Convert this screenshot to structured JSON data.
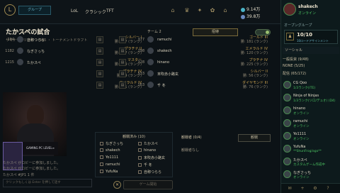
{
  "topbar": {
    "play_label": "グループ",
    "nav": [
      "LoL",
      "クラシック",
      "TFT"
    ],
    "currency": {
      "rp": "9.14万",
      "be": "39.8万"
    }
  },
  "lobby": {
    "title": "たかスペの試合",
    "subtitle": "サモナーズリフト ・ 5v5 ・ トーナメントドラフト",
    "invite_label": "招待",
    "team1_label": "チーム 1",
    "team2_label": "チーム 2"
  },
  "team1": [
    {
      "num": "104",
      "name": "自称つらら",
      "rank": "シルバー I",
      "sub": "勝: 177 (ランク)"
    },
    {
      "num": "1182",
      "name": "なぎさっち",
      "rank": "プラチナ II",
      "sub": "勝: 287 (ランク)"
    },
    {
      "num": "1215",
      "name": "たかスペ",
      "rank": "マスター",
      "sub": "勝: 279 (ランク)"
    },
    {
      "num": "",
      "name": "",
      "rank": "プラチナ IV",
      "sub": "勝: 84 (ランク)"
    },
    {
      "num": "",
      "name": "",
      "rank": "エメラルド IV",
      "sub": "勝: 181 (ランク)"
    }
  ],
  "team2": [
    {
      "num": "377",
      "name": "ramuchi",
      "rank": "ゴールド III",
      "sub": "勝: 181 (ランク)"
    },
    {
      "num": "198",
      "name": "shakech",
      "rank": "エメラルド IV",
      "sub": "勝: 120 (ランク)"
    },
    {
      "num": "328",
      "name": "hinano",
      "rank": "プラチナ IV",
      "sub": "勝: 225 (ランク)"
    },
    {
      "num": "533",
      "name": "末吹赤小路玄",
      "rank": "シルバー II",
      "sub": "勝: 56 (ランク)"
    },
    {
      "num": "163",
      "name": "千 冬",
      "rank": "ダイヤモンド III",
      "sub": "勝: 76 (ランク)"
    }
  ],
  "spectators": {
    "title": "観戦済み (10)",
    "items": [
      "なぎさっち",
      "たかスペ",
      "shakech",
      "hinano",
      "Yo1111",
      "末吹赤小路玄",
      "ramuchi",
      "千 冬",
      "YufuNa",
      "自称つらら"
    ]
  },
  "observers": {
    "title": "観戦者 (0/4)",
    "note": "観戦者なし",
    "button": "観戦"
  },
  "bottom": {
    "start_label": "ゲーム開始",
    "chat_placeholder": "クリックもしくは Enter を押して話す",
    "chat_lines": [
      "たかスペ がロビーに参加しました。",
      "たかスペ がロビーに参加しました。",
      "たかスペ #JP1 1 件"
    ],
    "brand": "GAMING PC LEVEL∞"
  },
  "side": {
    "me_name": "shakech",
    "me_status": "オンライン",
    "open_group": "オープングループ",
    "group_count": "10/10",
    "group_label": "10ロードアサインメント",
    "social": "ソーシャル",
    "categories": [
      "一般投資 (9/48)",
      "NONE (5/25)",
      "配信 (65/172)"
    ],
    "friends": [
      {
        "name": "CG Qoo",
        "status": "1/3ランク(ITE)"
      },
      {
        "name": "Ninja of Ninjas",
        "status": "1/3ランク(ソロ/デュオ) (D4)"
      },
      {
        "name": "hinano",
        "status": "オンライン"
      },
      {
        "name": "ramuchi",
        "status": "オンライン"
      },
      {
        "name": "Yo1111",
        "status": "オンライン"
      },
      {
        "name": "YufuNa",
        "status": "**ShunFrog/ago**"
      },
      {
        "name": "たかスペ",
        "status": "カスタムゲーム作成中"
      },
      {
        "name": "なぎさっち",
        "status": "オンライン"
      }
    ]
  }
}
